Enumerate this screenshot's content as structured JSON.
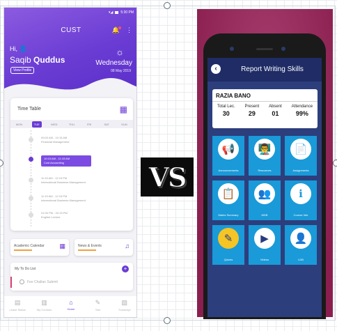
{
  "left_app": {
    "status_time": "5:30 PM",
    "title": "CUST",
    "greeting": "Hi,",
    "first_name": "Saqib",
    "last_name": "Quddus",
    "view_profile": "View Profile",
    "weekday": "Wednesday",
    "date": "08 May 2019",
    "timetable": {
      "title": "Time Table",
      "days": [
        "MON",
        "TUE",
        "WED",
        "THU",
        "FRI",
        "SAT",
        "SUN"
      ],
      "active_day": "TUE",
      "entries": [
        {
          "time": "09:00 AM - 10:15 AM",
          "course": "Financial Management",
          "active": false
        },
        {
          "time": "10:15 AM - 11:15 AM",
          "course": "Cost Accounting",
          "active": true
        },
        {
          "time": "11:15 AM - 12:15 PM",
          "course": "International Business Management",
          "active": false
        },
        {
          "time": "11:15 AM - 12:15 PM",
          "course": "International Business Management",
          "active": false
        },
        {
          "time": "01:00 PM - 02:15 PM",
          "course": "English Lecture",
          "active": false
        }
      ]
    },
    "academic_calendar": "Academic Calendar",
    "news_events": "News & Events",
    "todo": {
      "title": "My To Do List",
      "item": "Fee Challan Submit"
    },
    "nav": [
      {
        "label": "Leave Status",
        "icon": "grid-icon",
        "active": false
      },
      {
        "label": "My Courses",
        "icon": "courses-icon",
        "active": false
      },
      {
        "label": "Home",
        "icon": "home-icon",
        "active": true
      },
      {
        "label": "Test",
        "icon": "test-icon",
        "active": false
      },
      {
        "label": "Transcript",
        "icon": "transcript-icon",
        "active": false
      }
    ]
  },
  "vs_text": "VS",
  "right_app": {
    "title": "Report Writing Skills",
    "student_name": "RAZIA BANO",
    "stats": [
      {
        "label": "Total Lec.",
        "value": "30"
      },
      {
        "label": "Present",
        "value": "29"
      },
      {
        "label": "Absent",
        "value": "01"
      },
      {
        "label": "Attendance",
        "value": "99%"
      }
    ],
    "tiles": [
      {
        "label": "Announcements",
        "icon": "megaphone-icon",
        "circle": "#ffffff"
      },
      {
        "label": "Resources",
        "icon": "teacher-icon",
        "circle": "#ffffff"
      },
      {
        "label": "Assignments",
        "icon": "documents-icon",
        "circle": "#ffffff"
      },
      {
        "label": "Marks Summary",
        "icon": "checklist-icon",
        "circle": "#ffffff"
      },
      {
        "label": "MDB",
        "icon": "group-icon",
        "circle": "#ffffff"
      },
      {
        "label": "Course Info",
        "icon": "info-icon",
        "circle": "#ffffff"
      },
      {
        "label": "Quizes",
        "icon": "quiz-icon",
        "circle": "#f5c425"
      },
      {
        "label": "Videos",
        "icon": "video-icon",
        "circle": "#ffffff"
      },
      {
        "label": "LDB",
        "icon": "presenter-icon",
        "circle": "#ffffff"
      }
    ]
  }
}
